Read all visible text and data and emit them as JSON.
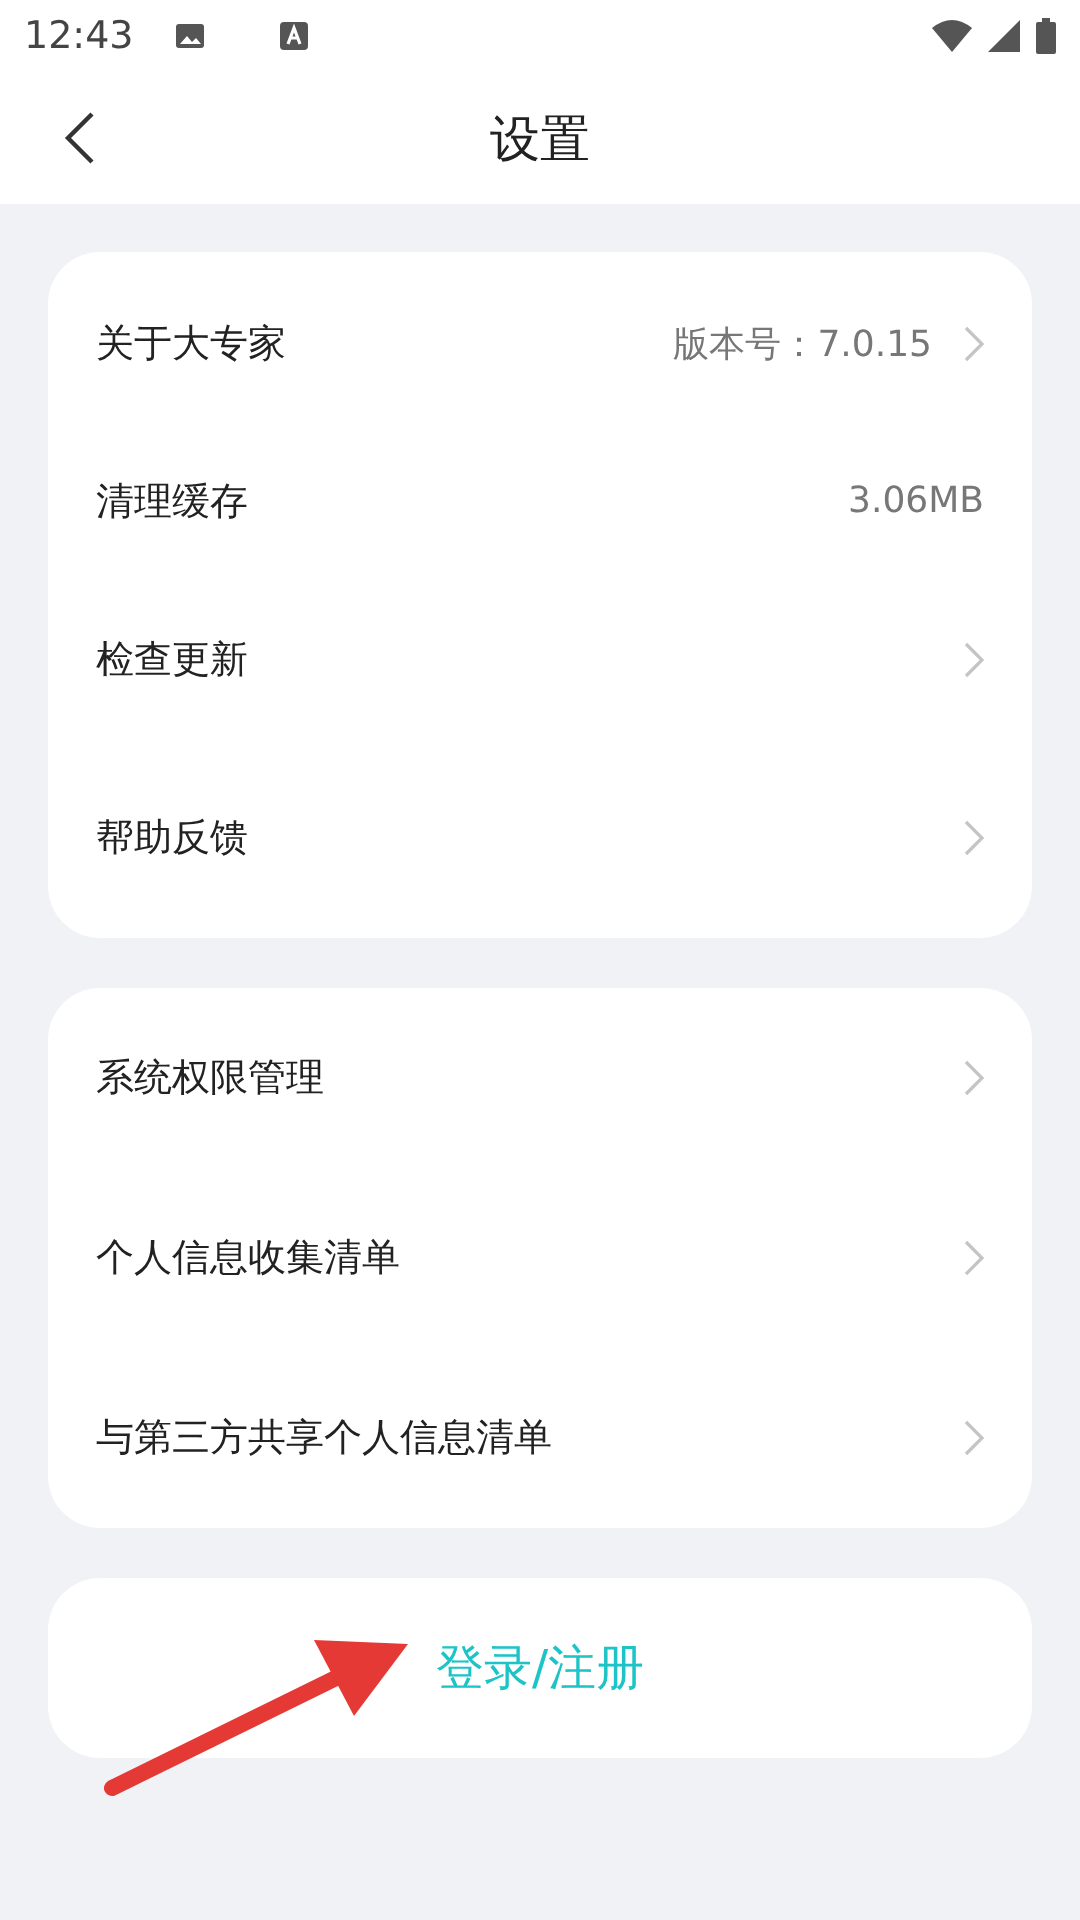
{
  "status_bar": {
    "time": "12:43"
  },
  "header": {
    "title": "设置"
  },
  "groups": [
    {
      "items": [
        {
          "label": "关于大专家",
          "value": "版本号：7.0.15",
          "chevron": true
        },
        {
          "label": "清理缓存",
          "value": "3.06MB",
          "chevron": false
        },
        {
          "label": "检查更新",
          "chevron": true
        },
        {
          "label": "帮助反馈",
          "chevron": true
        }
      ]
    },
    {
      "items": [
        {
          "label": "系统权限管理",
          "chevron": true
        },
        {
          "label": "个人信息收集清单",
          "chevron": true
        },
        {
          "label": "与第三方共享个人信息清单",
          "chevron": true
        }
      ]
    }
  ],
  "login_button": {
    "label": "登录/注册"
  }
}
